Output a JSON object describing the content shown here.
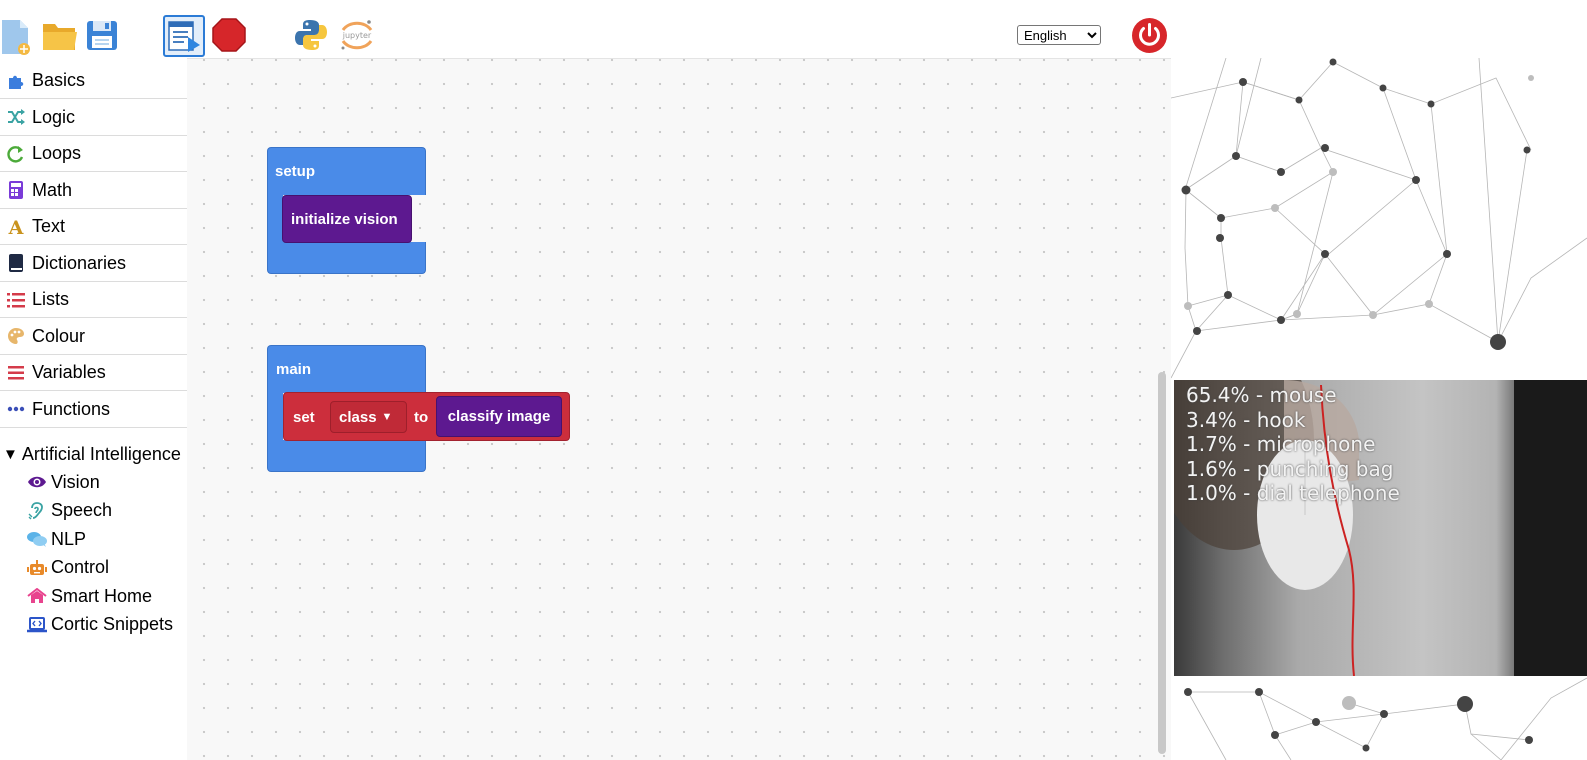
{
  "toolbar": {
    "language_selected": "English",
    "language_options": [
      "English"
    ]
  },
  "sidebar": {
    "categories": [
      {
        "label": "Basics",
        "icon": "puzzle-icon",
        "color": "#3b7ddd"
      },
      {
        "label": "Logic",
        "icon": "shuffle-icon",
        "color": "#3aa3a3"
      },
      {
        "label": "Loops",
        "icon": "loop-arrow-icon",
        "color": "#4caa3a"
      },
      {
        "label": "Math",
        "icon": "calculator-icon",
        "color": "#7a3bd8"
      },
      {
        "label": "Text",
        "icon": "letter-a-icon",
        "color": "#c9931e"
      },
      {
        "label": "Dictionaries",
        "icon": "book-icon",
        "color": "#1f2a44"
      },
      {
        "label": "Lists",
        "icon": "list-icon",
        "color": "#d43b4a"
      },
      {
        "label": "Colour",
        "icon": "palette-icon",
        "color": "#e7b66b"
      },
      {
        "label": "Variables",
        "icon": "bars-icon",
        "color": "#d43b4a"
      },
      {
        "label": "Functions",
        "icon": "ellipsis-icon",
        "color": "#3b4fb8"
      }
    ],
    "ai_section": {
      "label": "Artificial Intelligence",
      "items": [
        {
          "label": "Vision",
          "icon": "eye-icon",
          "color": "#5d1990"
        },
        {
          "label": "Speech",
          "icon": "ear-icon",
          "color": "#3aa3a3"
        },
        {
          "label": "NLP",
          "icon": "chat-bubbles-icon",
          "color": "#5bb3e8"
        },
        {
          "label": "Control",
          "icon": "robot-icon",
          "color": "#e88a2a"
        },
        {
          "label": "Smart Home",
          "icon": "home-icon",
          "color": "#e8448e"
        },
        {
          "label": "Cortic Snippets",
          "icon": "laptop-code-icon",
          "color": "#2c55c9"
        }
      ]
    }
  },
  "workspace": {
    "setup_block": {
      "label": "setup",
      "inner": "initialize vision"
    },
    "main_block": {
      "label": "main",
      "set_label": "set",
      "variable": "class",
      "to_label": "to",
      "value_block": "classify image"
    }
  },
  "camera": {
    "predictions": [
      "65.4% - mouse",
      "3.4% - hook",
      "1.7% - microphone",
      "1.6% - punching bag",
      "1.0% - dial telephone"
    ]
  }
}
